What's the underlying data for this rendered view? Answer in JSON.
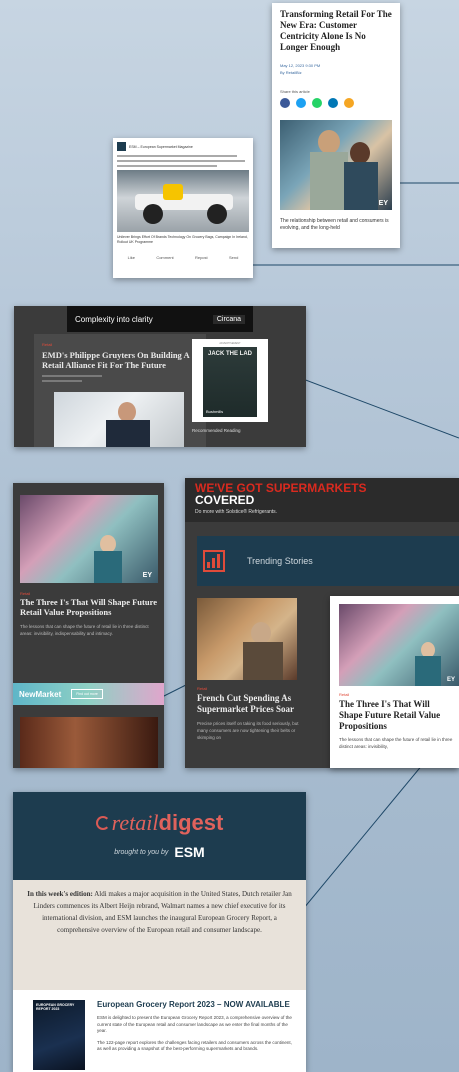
{
  "card1": {
    "title": "Transforming Retail For The New Era: Customer Centricity Alone Is No Longer Enough",
    "date": "May 12, 2023 9:30 PM",
    "byline": "By RetailBiz",
    "share": "Share this article",
    "caption": "The relationship between retail and consumers is evolving, and the long-held",
    "share_colors": [
      "#3b5998",
      "#1da1f2",
      "#25d366",
      "#0077b5",
      "#f5a623"
    ]
  },
  "card2": {
    "source": "ESM – European Supermarket Magazine",
    "caption": "Unilever Brings Effort Of Brands Technology On Grocery Bags, Campaign In Ireland, Rollout UK Programme",
    "actions": [
      "Like",
      "Comment",
      "Repost",
      "Send"
    ]
  },
  "card3": {
    "banner_text": "Complexity into clarity",
    "banner_brand": "Circana",
    "kicker": "Retail",
    "headline": "EMD's Philippe Gruyters On Building A Retail Alliance Fit For The Future",
    "ad_label": "ADVERTISEMENT",
    "ad_title": "JACK THE LAD",
    "ad_brand": "Bushmills",
    "recommended": "Recommended Reading"
  },
  "card4": {
    "kicker": "Retail",
    "headline": "The Three I's That Will Shape Future Retail Value Propositions",
    "body": "The lessons that can shape the future of retail lie in three distinct areas: invisibility, indispensability and intimacy.",
    "newmarket": "NewMarket",
    "newmarket_btn": "Find out more"
  },
  "card5": {
    "banner_line1": "WE'VE GOT SUPERMARKETS",
    "banner_line2": "COVERED",
    "banner_sub": "Do more with Solstice® Refrigerants.",
    "trending": "Trending Stories",
    "story1_kicker": "Retail",
    "story1_title": "French Cut Spending As Supermarket Prices Soar",
    "story1_body": "Precise prices itself on taking its food seriously, but many consumers are now tightening their belts or skimping on",
    "story2_kicker": "Retail",
    "story2_title": "The Three I's That Will Shape Future Retail Value Propositions",
    "story2_body": "The lessons that can shape the future of retail lie in three distinct areas: invisibility,"
  },
  "card6": {
    "brand_retail": "retail",
    "brand_digest": "digest",
    "brought": "brought to you by",
    "esm": "ESM",
    "edition_lead": "In this week's edition:",
    "edition_body": "Aldi makes a major acquisition in the United States, Dutch retailer Jan Linders commences its Albert Heijn rebrand, Walmart names a new chief executive for its international division, and ESM launches the inaugural European Grocery Report, a comprehensive overview of the European retail and consumer landscape.",
    "report_cover_title": "EUROPEAN GROCERY REPORT 2023",
    "report_title": "European Grocery Report 2023 – NOW AVAILABLE",
    "report_p1": "ESM is delighted to present the European Grocery Report 2023, a comprehensive overview of the current state of the European retail and consumer landscape as we enter the final months of the year.",
    "report_p2": "The 122-page report explores the challenges facing retailers and consumers across the continent, as well as providing a snapshot of the best-performing supermarkets and brands."
  },
  "colors": {
    "teal": "#1d3c4f",
    "red": "#d9534f",
    "orange": "#e8542c",
    "dark_panel": "#3b3b3b",
    "line": "#1e4868"
  }
}
